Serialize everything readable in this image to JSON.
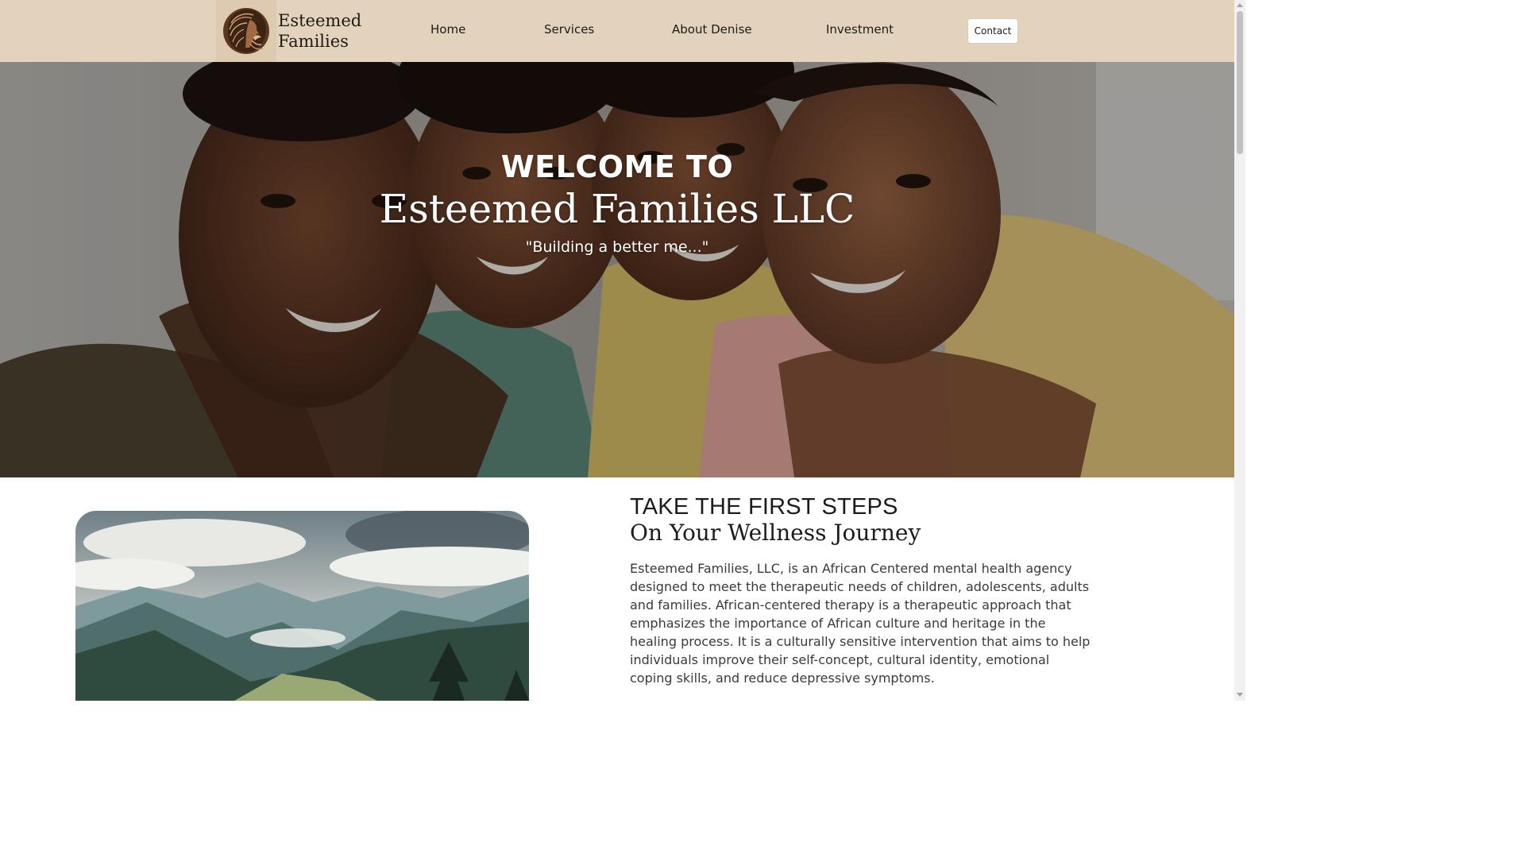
{
  "brand": {
    "name_line1": "Esteemed",
    "name_line2": "Families",
    "logo_icon": "woman-profile-logo-icon"
  },
  "nav": {
    "items": [
      {
        "label": "Home"
      },
      {
        "label": "Services"
      },
      {
        "label": "About Denise"
      },
      {
        "label": "Investment"
      }
    ],
    "contact_label": "Contact"
  },
  "hero": {
    "welcome": "WELCOME TO",
    "title": "Esteemed Families LLC",
    "tagline": "\"Building a better me...\""
  },
  "intro": {
    "heading": "TAKE THE FIRST STEPS",
    "subheading": "On Your Wellness Journey",
    "body": "Esteemed Families, LLC, is an African Centered mental health agency designed to meet the therapeutic needs of children, adolescents, adults and families. African-centered therapy is a therapeutic approach that emphasizes the importance of African culture and heritage in the healing process. It is a culturally sensitive intervention that aims to help individuals improve their self-concept, cultural identity, emotional coping skills, and reduce depressive symptoms."
  },
  "colors": {
    "header_bg": "#e3d3bd",
    "text_dark": "#1c1c1c",
    "body_text": "#3a3a3a"
  }
}
